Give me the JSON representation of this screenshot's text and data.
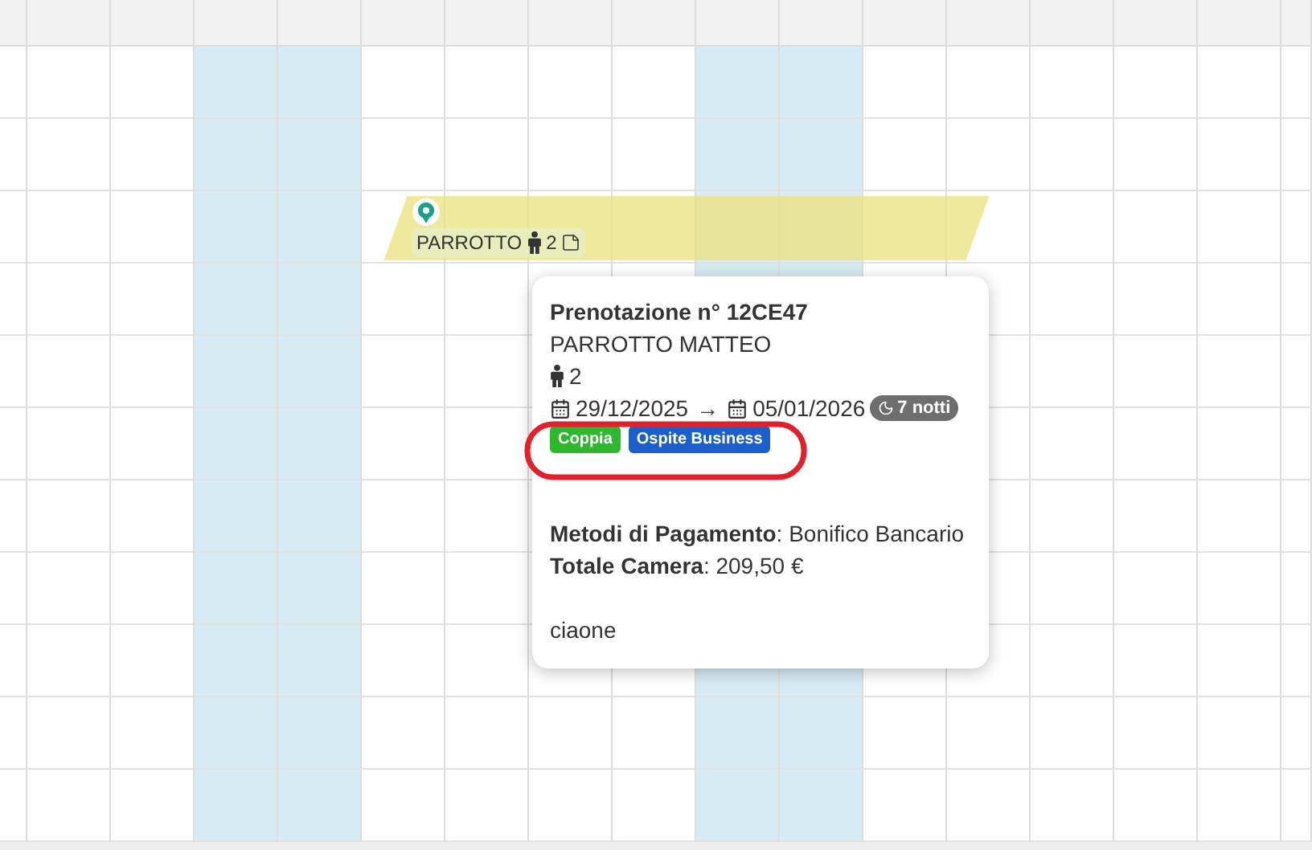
{
  "calendar": {
    "columns": [
      {
        "weekend": false
      },
      {
        "weekend": false
      },
      {
        "weekend": false
      },
      {
        "weekend": true
      },
      {
        "weekend": true
      },
      {
        "weekend": false
      },
      {
        "weekend": false
      },
      {
        "weekend": false
      },
      {
        "weekend": false
      },
      {
        "weekend": true
      },
      {
        "weekend": true
      },
      {
        "weekend": false
      },
      {
        "weekend": false
      },
      {
        "weekend": false
      },
      {
        "weekend": false
      },
      {
        "weekend": false
      },
      {
        "weekend": false
      }
    ]
  },
  "booking": {
    "label": "PARROTTO",
    "guests": "2"
  },
  "tooltip": {
    "title": "Prenotazione n° 12CE47",
    "guest_name": "PARROTTO MATTEO",
    "guests": "2",
    "check_in": "29/12/2025",
    "arrow": "→",
    "check_out": "05/01/2026",
    "nights": "7 notti",
    "tags": [
      {
        "label": "Coppia",
        "color": "#2fb72f"
      },
      {
        "label": "Ospite Business",
        "color": "#1c5fc9"
      }
    ],
    "payment": "**Metodi di Pagamento**: Bonifico Bancario",
    "total": "**Totale Camera**: 209,50 €",
    "note": "ciaone"
  }
}
